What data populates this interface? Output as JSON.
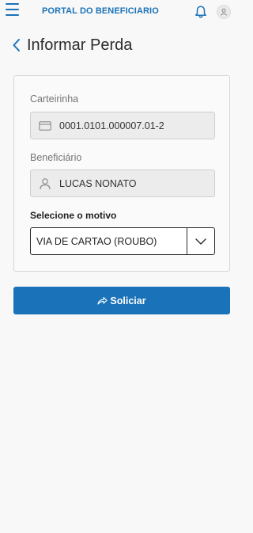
{
  "header": {
    "brand": "PORTAL DO BENEFICIARIO",
    "icons": [
      "menu-icon",
      "bell-icon",
      "user-icon"
    ]
  },
  "page": {
    "title": "Informar Perda"
  },
  "form": {
    "card_label": "Carteirinha",
    "card_value": "0001.0101.000007.01-2",
    "card_icon": "credit-card-icon",
    "beneficiary_label": "Beneficiário",
    "beneficiary_value": "LUCAS NONATO",
    "beneficiary_icon": "user-icon",
    "reason_label": "Selecione o motivo",
    "reason_value": "VIA DE CARTAO (ROUBO)",
    "submit_label": "Soliciar",
    "submit_icon": "share-arrow-icon"
  },
  "colors": {
    "accent": "#1a72b8",
    "background": "#f8f8f8"
  }
}
